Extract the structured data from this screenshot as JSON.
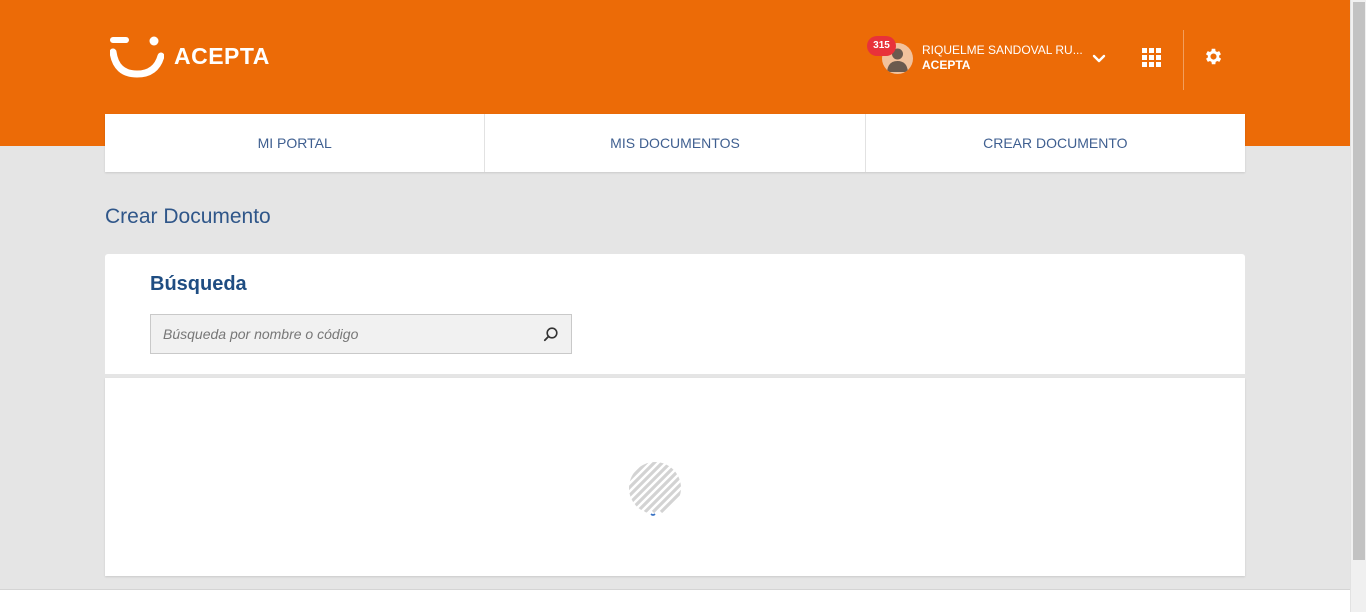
{
  "header": {
    "brand": "ACEPTA",
    "notification_count": "315",
    "user_name": "RIQUELME SANDOVAL RU...",
    "user_org": "ACEPTA",
    "icons": [
      "logo-smile-icon",
      "user-avatar-icon",
      "chevron-down-icon",
      "apps-grid-icon",
      "gear-icon"
    ]
  },
  "nav": {
    "items": [
      {
        "label": "MI PORTAL"
      },
      {
        "label": "MIS DOCUMENTOS"
      },
      {
        "label": "CREAR DOCUMENTO"
      }
    ]
  },
  "page": {
    "title": "Crear Documento"
  },
  "search": {
    "title": "Búsqueda",
    "placeholder": "Búsqueda por nombre o código",
    "value": ""
  },
  "colors": {
    "brand_orange": "#ec6b07",
    "nav_text": "#3f5f90",
    "title_blue": "#2f5689",
    "badge_red": "#e8323a",
    "background": "#e5e5e5"
  }
}
